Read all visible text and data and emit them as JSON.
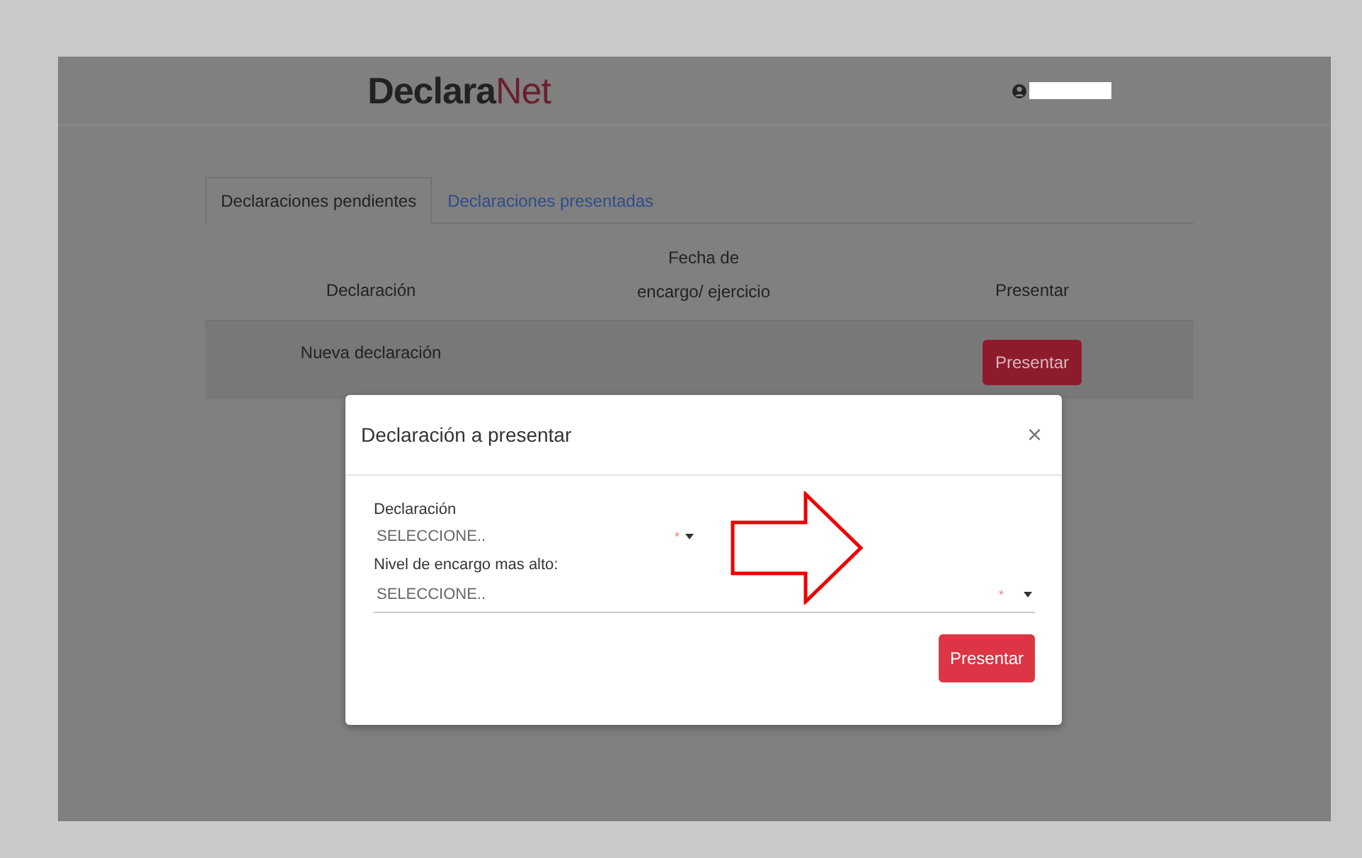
{
  "header": {
    "logo": "**Declara**Net"
  },
  "tabs": [
    {
      "label": "Declaraciones pendientes",
      "selected": true
    },
    {
      "label": "Declaraciones presentadas",
      "selected": false
    }
  ],
  "table": {
    "columns": [
      "Declaración",
      "Fecha de encargo/ ejercicio",
      "Presentar"
    ],
    "rows": [
      {
        "declaration": "Nueva declaración",
        "action": "Presentar"
      }
    ]
  },
  "dialog": {
    "title": "Declaración a presentar",
    "close": "×",
    "fields": [
      {
        "label": "Declaración",
        "placeholder": "SELECCIONE..",
        "required_mark": "*"
      },
      {
        "label": "Nivel de encargo mas alto:",
        "placeholder": "SELECCIONE..",
        "required_mark": "*"
      }
    ],
    "submit": "Presentar"
  }
}
